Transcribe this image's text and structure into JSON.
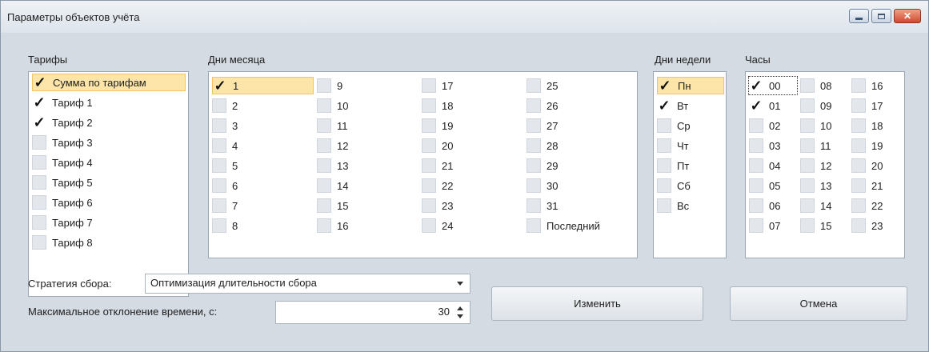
{
  "window": {
    "title": "Параметры объектов учёта",
    "controls": {
      "minimize": "minimize-icon",
      "maximize": "maximize-icon",
      "close": "close-icon"
    }
  },
  "tariffs": {
    "label": "Тарифы",
    "items": [
      {
        "label": "Сумма по тарифам",
        "checked": true,
        "selected": true
      },
      {
        "label": "Тариф 1",
        "checked": true
      },
      {
        "label": "Тариф 2",
        "checked": true
      },
      {
        "label": "Тариф 3",
        "checked": false
      },
      {
        "label": "Тариф 4",
        "checked": false
      },
      {
        "label": "Тариф 5",
        "checked": false
      },
      {
        "label": "Тариф 6",
        "checked": false
      },
      {
        "label": "Тариф 7",
        "checked": false
      },
      {
        "label": "Тариф 8",
        "checked": false
      }
    ]
  },
  "month_days": {
    "label": "Дни месяца",
    "columns": [
      [
        {
          "label": "1",
          "checked": true,
          "selected": true
        },
        {
          "label": "2"
        },
        {
          "label": "3"
        },
        {
          "label": "4"
        },
        {
          "label": "5"
        },
        {
          "label": "6"
        },
        {
          "label": "7"
        },
        {
          "label": "8"
        }
      ],
      [
        {
          "label": "9"
        },
        {
          "label": "10"
        },
        {
          "label": "11"
        },
        {
          "label": "12"
        },
        {
          "label": "13"
        },
        {
          "label": "14"
        },
        {
          "label": "15"
        },
        {
          "label": "16"
        }
      ],
      [
        {
          "label": "17"
        },
        {
          "label": "18"
        },
        {
          "label": "19"
        },
        {
          "label": "20"
        },
        {
          "label": "21"
        },
        {
          "label": "22"
        },
        {
          "label": "23"
        },
        {
          "label": "24"
        }
      ],
      [
        {
          "label": "25"
        },
        {
          "label": "26"
        },
        {
          "label": "27"
        },
        {
          "label": "28"
        },
        {
          "label": "29"
        },
        {
          "label": "30"
        },
        {
          "label": "31"
        },
        {
          "label": "Последний"
        }
      ]
    ]
  },
  "week_days": {
    "label": "Дни недели",
    "items": [
      {
        "label": "Пн",
        "checked": true,
        "selected": true
      },
      {
        "label": "Вт",
        "checked": true
      },
      {
        "label": "Ср",
        "checked": false
      },
      {
        "label": "Чт",
        "checked": false
      },
      {
        "label": "Пт",
        "checked": false
      },
      {
        "label": "Сб",
        "checked": false
      },
      {
        "label": "Вс",
        "checked": false
      }
    ]
  },
  "hours": {
    "label": "Часы",
    "columns": [
      [
        {
          "label": "00",
          "checked": true,
          "focused": true
        },
        {
          "label": "01",
          "checked": true
        },
        {
          "label": "02"
        },
        {
          "label": "03"
        },
        {
          "label": "04"
        },
        {
          "label": "05"
        },
        {
          "label": "06"
        },
        {
          "label": "07"
        }
      ],
      [
        {
          "label": "08"
        },
        {
          "label": "09"
        },
        {
          "label": "10"
        },
        {
          "label": "11"
        },
        {
          "label": "12"
        },
        {
          "label": "13"
        },
        {
          "label": "14"
        },
        {
          "label": "15"
        }
      ],
      [
        {
          "label": "16"
        },
        {
          "label": "17"
        },
        {
          "label": "18"
        },
        {
          "label": "19"
        },
        {
          "label": "20"
        },
        {
          "label": "21"
        },
        {
          "label": "22"
        },
        {
          "label": "23"
        }
      ]
    ]
  },
  "strategy": {
    "label": "Стратегия сбора:",
    "value": "Оптимизация длительности сбора"
  },
  "deviation": {
    "label": "Максимальное отклонение времени, с:",
    "value": "30"
  },
  "buttons": {
    "change": "Изменить",
    "cancel": "Отмена"
  }
}
